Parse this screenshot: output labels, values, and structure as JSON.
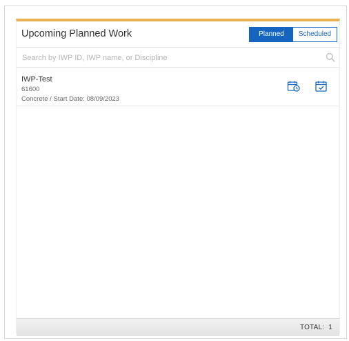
{
  "panel": {
    "title": "Upcoming Planned Work",
    "toggle": {
      "planned_label": "Planned",
      "scheduled_label": "Scheduled",
      "active": "Planned"
    }
  },
  "search": {
    "placeholder": "Search by IWP ID, IWP name, or Discipline",
    "value": ""
  },
  "items": [
    {
      "name": "IWP-Test",
      "id": "61600",
      "meta": "Concrete / Start Date: 08/09/2023",
      "actions": [
        "calendar-clock-icon",
        "calendar-check-icon"
      ]
    }
  ],
  "footer": {
    "total_label": "TOTAL:",
    "total_value": "1"
  },
  "colors": {
    "accent_bar": "#e8b04f",
    "primary": "#1565c0"
  }
}
